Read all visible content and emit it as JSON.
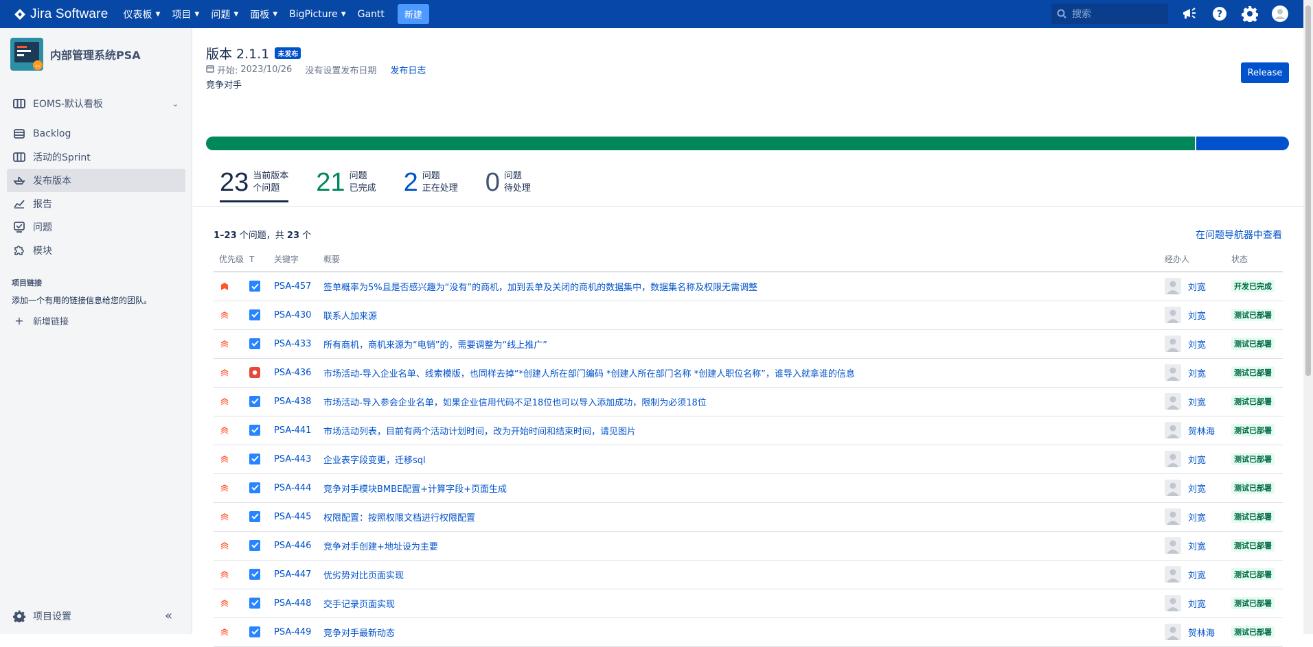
{
  "topnav": {
    "product": "Jira Software",
    "menu": [
      {
        "label": "仪表板",
        "dropdown": true
      },
      {
        "label": "项目",
        "dropdown": true
      },
      {
        "label": "问题",
        "dropdown": true
      },
      {
        "label": "面板",
        "dropdown": true
      },
      {
        "label": "BigPicture",
        "dropdown": true
      },
      {
        "label": "Gantt",
        "dropdown": false
      }
    ],
    "create_label": "新建",
    "search_placeholder": "搜索",
    "icons": [
      "megaphone-icon",
      "help-icon",
      "settings-icon",
      "user-avatar-icon"
    ],
    "colors": {
      "bar": "#0747a6",
      "create": "#4c9aff"
    }
  },
  "sidebar": {
    "project_name": "内部管理系统PSA",
    "board_selector": "EOMS-默认看板",
    "items": [
      {
        "label": "Backlog",
        "icon": "backlog-icon",
        "selected": false
      },
      {
        "label": "活动的Sprint",
        "icon": "board-icon",
        "selected": false
      },
      {
        "label": "发布版本",
        "icon": "ship-icon",
        "selected": true
      },
      {
        "label": "报告",
        "icon": "chart-icon",
        "selected": false
      },
      {
        "label": "问题",
        "icon": "issues-icon",
        "selected": false
      },
      {
        "label": "模块",
        "icon": "puzzle-icon",
        "selected": false
      }
    ],
    "links_title": "项目链接",
    "links_desc": "添加一个有用的链接信息给您的团队。",
    "add_link": "新增链接",
    "settings": "项目设置"
  },
  "version": {
    "title": "版本 2.1.1",
    "badge": "未发布",
    "start_label": "开始:",
    "start_date": "2023/10/26",
    "no_release_date": "没有设置发布日期",
    "release_notes": "发布日志",
    "description": "竞争对手",
    "release_button": "Release"
  },
  "progress": {
    "done": 21,
    "in_progress": 2,
    "todo": 0,
    "total": 23
  },
  "stats": [
    {
      "num": "23",
      "line1": "当前版本",
      "line2": "个问题",
      "color": "#172b4d"
    },
    {
      "num": "21",
      "line1": "问题",
      "line2": "已完成",
      "color": "#00875a"
    },
    {
      "num": "2",
      "line1": "问题",
      "line2": "正在处理",
      "color": "#0052cc"
    },
    {
      "num": "0",
      "line1": "问题",
      "line2": "待处理",
      "color": "#42526e"
    }
  ],
  "list": {
    "range": "1–23",
    "count_mid": " 个问题，共 ",
    "total": "23",
    "count_suffix": " 个",
    "view_in_navigator": "在问题导航器中查看",
    "headers": {
      "priority": "优先级",
      "type": "T",
      "key": "关键字",
      "summary": "概要",
      "assignee": "经办人",
      "status": "状态"
    },
    "rows": [
      {
        "priority": "highest",
        "type": "task",
        "key": "PSA-457",
        "summary": "签单概率为5%且是否感兴趣为“没有”的商机，加到丢单及关闭的商机的数据集中，数据集名称及权限无需调整",
        "assignee": "刘宽",
        "status": "开发已完成"
      },
      {
        "priority": "high",
        "type": "task",
        "key": "PSA-430",
        "summary": "联系人加来源",
        "assignee": "刘宽",
        "status": "测试已部署"
      },
      {
        "priority": "high",
        "type": "task",
        "key": "PSA-433",
        "summary": "所有商机，商机来源为“电销”的，需要调整为“线上推广”",
        "assignee": "刘宽",
        "status": "测试已部署"
      },
      {
        "priority": "high",
        "type": "bug",
        "key": "PSA-436",
        "summary": "市场活动-导入企业名单、线索模版，也同样去掉“*创建人所在部门编码 *创建人所在部门名称 *创建人职位名称”，谁导入就拿谁的信息",
        "assignee": "刘宽",
        "status": "测试已部署"
      },
      {
        "priority": "high",
        "type": "task",
        "key": "PSA-438",
        "summary": "市场活动-导入参会企业名单，如果企业信用代码不足18位也可以导入添加成功，限制为必须18位",
        "assignee": "刘宽",
        "status": "测试已部署"
      },
      {
        "priority": "high",
        "type": "task",
        "key": "PSA-441",
        "summary": "市场活动列表，目前有两个活动计划时间，改为开始时间和结束时间，请见图片",
        "assignee": "贺林海",
        "status": "测试已部署"
      },
      {
        "priority": "high",
        "type": "task",
        "key": "PSA-443",
        "summary": "企业表字段变更，迁移sql",
        "assignee": "刘宽",
        "status": "测试已部署"
      },
      {
        "priority": "high",
        "type": "task",
        "key": "PSA-444",
        "summary": "竞争对手模块BMBE配置+计算字段+页面生成",
        "assignee": "刘宽",
        "status": "测试已部署"
      },
      {
        "priority": "high",
        "type": "task",
        "key": "PSA-445",
        "summary": "权限配置：按照权限文档进行权限配置",
        "assignee": "刘宽",
        "status": "测试已部署"
      },
      {
        "priority": "high",
        "type": "task",
        "key": "PSA-446",
        "summary": "竞争对手创建+地址设为主要",
        "assignee": "刘宽",
        "status": "测试已部署"
      },
      {
        "priority": "high",
        "type": "task",
        "key": "PSA-447",
        "summary": "优劣势对比页面实现",
        "assignee": "刘宽",
        "status": "测试已部署"
      },
      {
        "priority": "high",
        "type": "task",
        "key": "PSA-448",
        "summary": "交手记录页面实现",
        "assignee": "刘宽",
        "status": "测试已部署"
      },
      {
        "priority": "high",
        "type": "task",
        "key": "PSA-449",
        "summary": "竞争对手最新动态",
        "assignee": "贺林海",
        "status": "测试已部署"
      }
    ]
  }
}
